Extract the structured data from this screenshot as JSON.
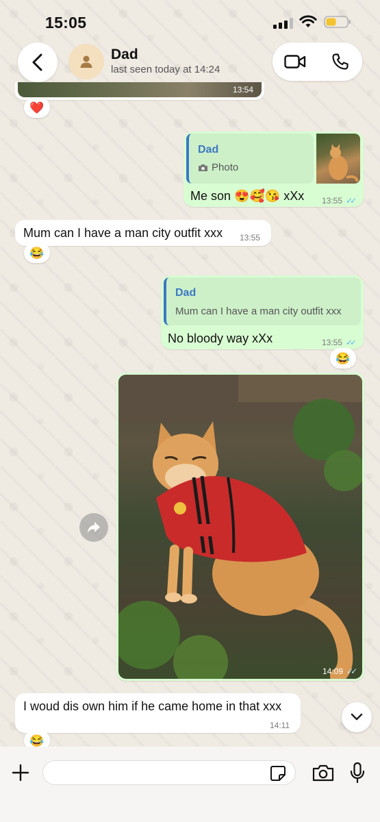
{
  "status_bar": {
    "time": "15:05"
  },
  "header": {
    "contact_name": "Dad",
    "contact_status": "last seen today at 14:24"
  },
  "icons": {
    "back": "chevron-left-icon",
    "avatar": "person-icon",
    "video": "video-camera-icon",
    "phone": "phone-icon",
    "forward": "forward-icon",
    "scroll": "chevron-down-icon",
    "plus": "plus-icon",
    "sticker": "sticker-icon",
    "camera": "camera-icon",
    "mic": "microphone-icon"
  },
  "colors": {
    "outgoing_bubble": "#d9fdd3",
    "incoming_bubble": "#ffffff",
    "quote_accent": "#3b78c4",
    "read_ticks": "#53bdeb",
    "wallpaper": "#efeae2"
  },
  "messages": [
    {
      "id": "photo_top",
      "direction": "incoming",
      "type": "photo",
      "time": "13:54",
      "reaction": "❤️"
    },
    {
      "id": "me_son",
      "direction": "outgoing",
      "quote": {
        "name": "Dad",
        "text": "Photo"
      },
      "text": "Me son 😍🥰😘 xXx",
      "time": "13:55",
      "read": true
    },
    {
      "id": "mum_outfit",
      "direction": "incoming",
      "text": "Mum can I have a man city outfit xxx",
      "time": "13:55",
      "reaction": "😂"
    },
    {
      "id": "no_bloody_way",
      "direction": "outgoing",
      "quote": {
        "name": "Dad",
        "text": "Mum can I have a man city outfit xxx"
      },
      "text": "No bloody way xXx",
      "time": "13:55",
      "read": true,
      "reaction": "😂"
    },
    {
      "id": "cat_photo",
      "direction": "outgoing",
      "type": "photo",
      "time": "14:09",
      "read": true
    },
    {
      "id": "disown",
      "direction": "incoming",
      "text": "I woud dis own him if he came home in that xxx",
      "time": "14:11",
      "reaction": "😂"
    }
  ],
  "composer": {
    "value": ""
  }
}
